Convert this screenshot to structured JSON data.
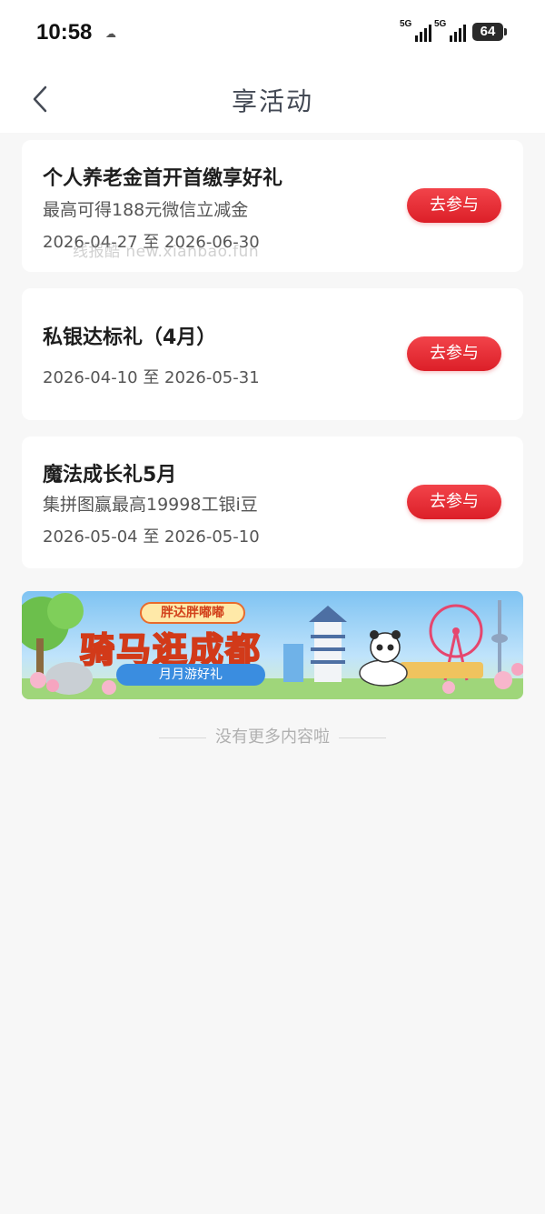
{
  "status_bar": {
    "time": "10:58",
    "signal_1_label": "5G",
    "signal_2_label": "5G",
    "battery": "64"
  },
  "header": {
    "title": "享活动",
    "back_icon": "chevron-left-icon"
  },
  "activities": [
    {
      "title": "个人养老金首开首缴享好礼",
      "subtitle": "最高可得188元微信立减金",
      "date": "2026-04-27 至 2026-06-30",
      "button": "去参与"
    },
    {
      "title": "私银达标礼（4月）",
      "subtitle": "",
      "date": "2026-04-10 至 2026-05-31",
      "button": "去参与"
    },
    {
      "title": "魔法成长礼5月",
      "subtitle": "集拼图赢最高19998工银i豆",
      "date": "2026-05-04 至 2026-05-10",
      "button": "去参与"
    }
  ],
  "watermark": "线报酷 new.xianbao.fun",
  "banner": {
    "tag": "胖达胖嘟嘟",
    "title": "骑马逛成都",
    "subtitle": "月月游好礼"
  },
  "footer": {
    "no_more": "没有更多内容啦"
  },
  "colors": {
    "accent": "#e32a31",
    "background": "#f7f7f7"
  }
}
